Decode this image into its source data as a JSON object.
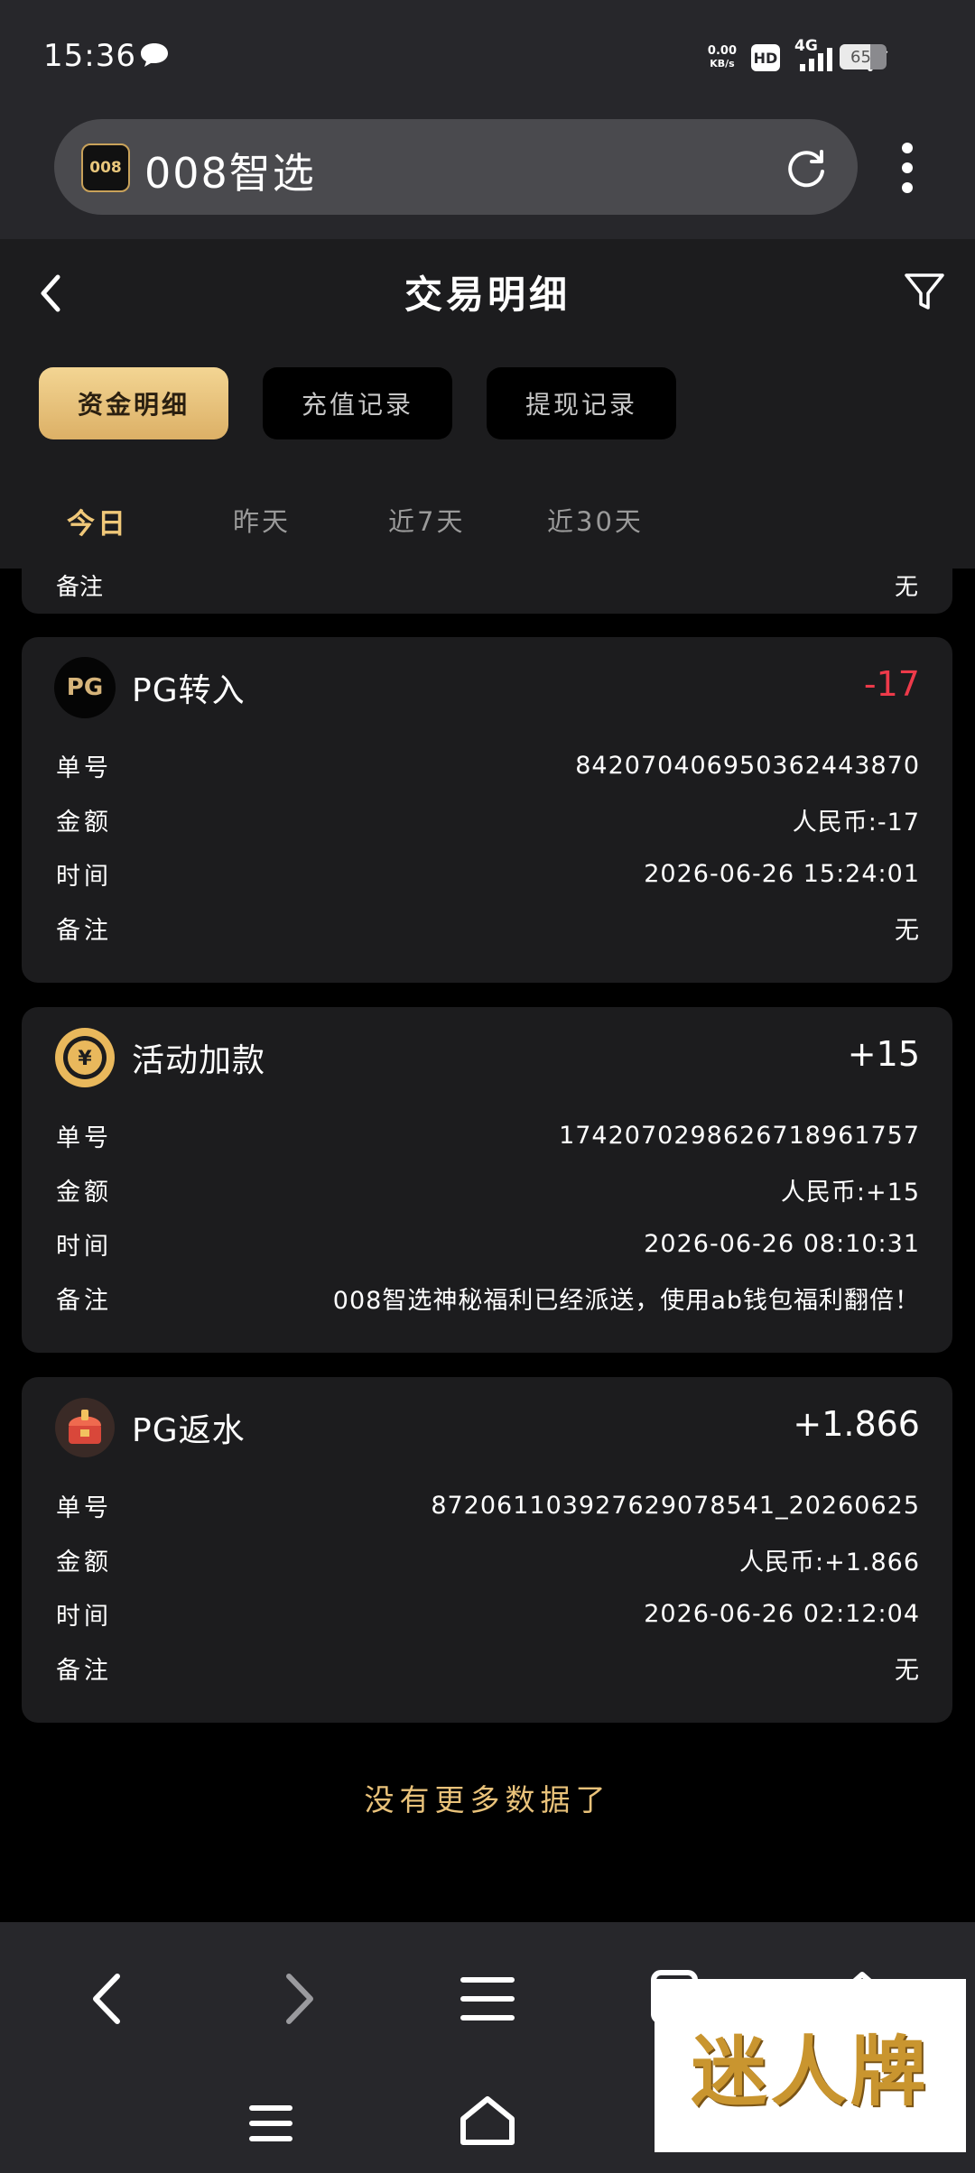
{
  "status": {
    "time": "15:36",
    "net_speed_value": "0.00",
    "net_speed_unit": "KB/s",
    "hd": "HD",
    "signal": "4G",
    "battery": "65"
  },
  "browser": {
    "logo_text": "008",
    "title": "008智选"
  },
  "header": {
    "title": "交易明细"
  },
  "tabs": [
    {
      "label": "资金明细",
      "active": true
    },
    {
      "label": "充值记录",
      "active": false
    },
    {
      "label": "提现记录",
      "active": false
    }
  ],
  "day_tabs": [
    {
      "label": "今日",
      "active": true
    },
    {
      "label": "昨天",
      "active": false
    },
    {
      "label": "近7天",
      "active": false
    },
    {
      "label": "近30天",
      "active": false
    }
  ],
  "partial_card": {
    "key": "备注",
    "value": "无"
  },
  "labels": {
    "order": "单号",
    "amount": "金额",
    "time": "时间",
    "remark": "备注"
  },
  "transactions": [
    {
      "title": "PG转入",
      "amount": "-17",
      "order_no": "842070406950362443870",
      "amount_detail": "人民币:-17",
      "time": "2026-06-26 15:24:01",
      "remark": "无",
      "icon": "pg-icon"
    },
    {
      "title": "活动加款",
      "amount": "+15",
      "order_no": "1742070298626718961757",
      "amount_detail": "人民币:+15",
      "time": "2026-06-26 08:10:31",
      "remark": "008智选神秘福利已经派送，使用ab钱包福利翻倍！",
      "icon": "coin-icon"
    },
    {
      "title": "PG返水",
      "amount": "+1.866",
      "order_no": "872061103927629078541_20260625",
      "amount_detail": "人民币:+1.866",
      "time": "2026-06-26 02:12:04",
      "remark": "无",
      "icon": "treasure-icon"
    }
  ],
  "footer_text": "没有更多数据了",
  "watermark": "迷人牌",
  "colors": {
    "accent_gold": "#f0c879",
    "negative": "#ee3a4a",
    "card_bg": "#1c1c1e"
  }
}
